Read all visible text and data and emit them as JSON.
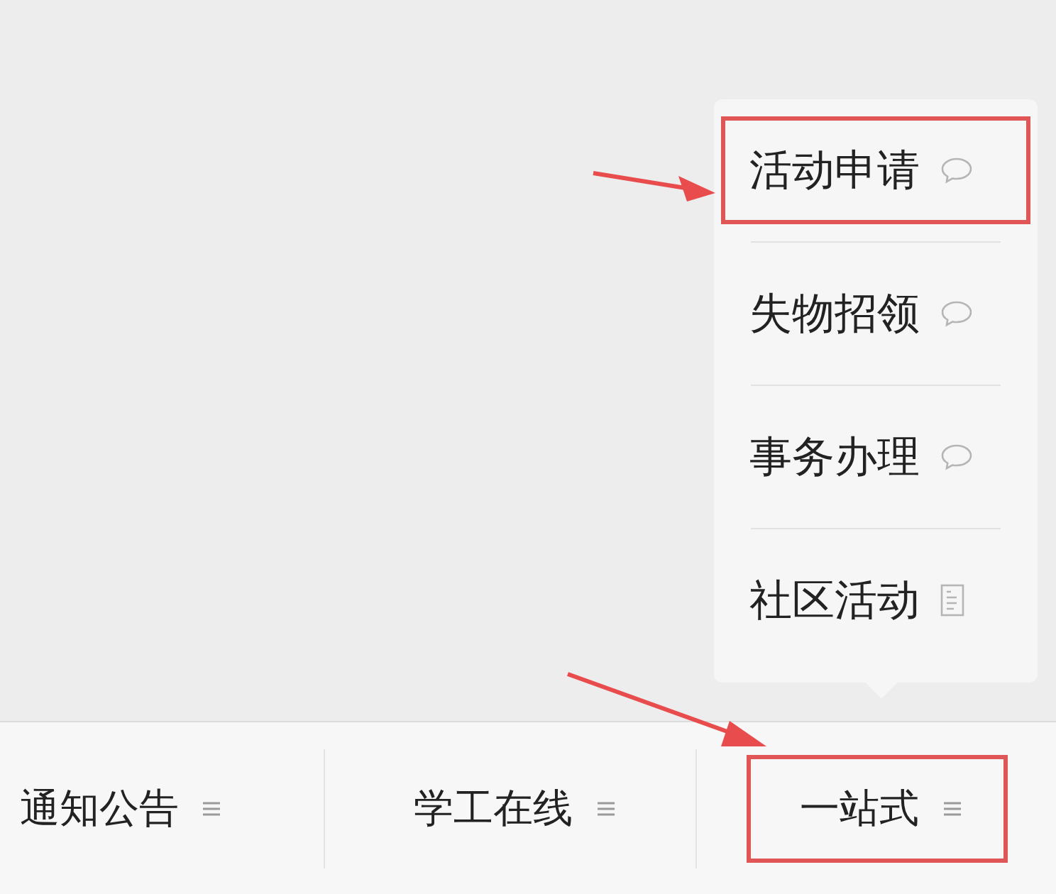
{
  "popup_menu": {
    "items": [
      {
        "label": "活动申请",
        "kind": "chat",
        "highlighted": true
      },
      {
        "label": "失物招领",
        "kind": "chat",
        "highlighted": false
      },
      {
        "label": "事务办理",
        "kind": "chat",
        "highlighted": false
      },
      {
        "label": "社区活动",
        "kind": "page",
        "highlighted": false
      }
    ]
  },
  "bottom_menu": {
    "tabs": [
      {
        "label": "通知公告",
        "highlighted": false
      },
      {
        "label": "学工在线",
        "highlighted": false
      },
      {
        "label": "一站式",
        "highlighted": true
      }
    ]
  }
}
